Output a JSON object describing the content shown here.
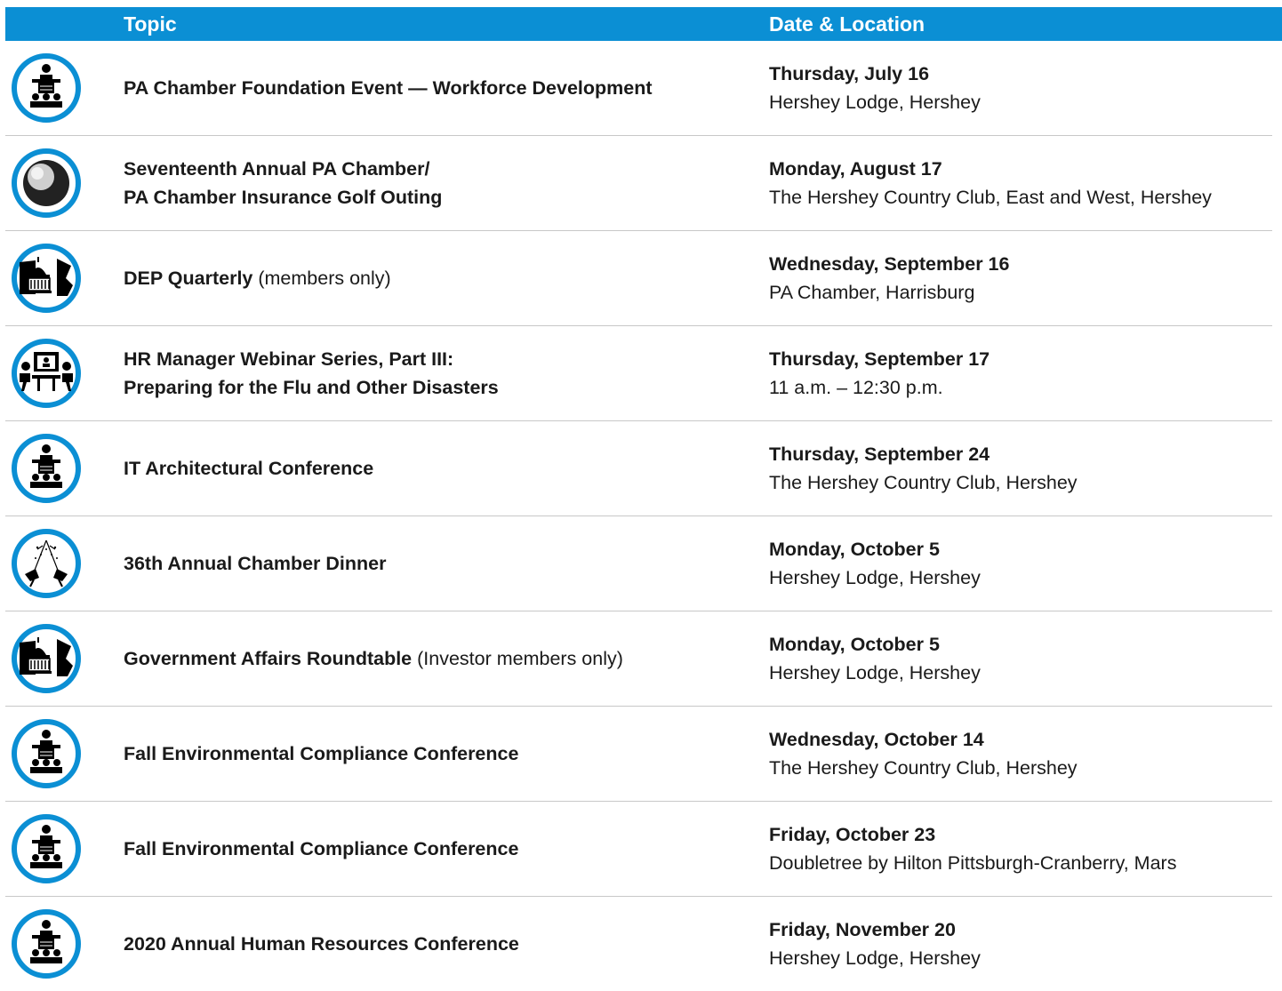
{
  "header": {
    "topic": "Topic",
    "date_location": "Date & Location"
  },
  "colors": {
    "accent": "#0b8fd4",
    "divider": "#c8c8c8"
  },
  "events": [
    {
      "icon": "conference-icon",
      "title_line1": "PA Chamber Foundation Event — Workforce Development",
      "title_line2": "",
      "note": "",
      "day": "Thursday, July 16",
      "location": "Hershey Lodge, Hershey"
    },
    {
      "icon": "golf-ball-icon",
      "title_line1": "Seventeenth Annual PA Chamber/",
      "title_line2": "PA Chamber Insurance Golf Outing",
      "note": "",
      "day": "Monday, August 17",
      "location": "The Hershey Country Club, East and West, Hershey"
    },
    {
      "icon": "capitol-map-icon",
      "title_line1": "DEP Quarterly",
      "title_line2": "",
      "note": " (members only)",
      "day": "Wednesday, September 16",
      "location": "PA Chamber, Harrisburg"
    },
    {
      "icon": "webinar-icon",
      "title_line1": "HR Manager Webinar Series, Part III:",
      "title_line2": "Preparing for the Flu and Other Disasters",
      "note": "",
      "day": "Thursday, September 17",
      "location": "11 a.m. – 12:30 p.m."
    },
    {
      "icon": "conference-icon",
      "title_line1": "IT Architectural Conference",
      "title_line2": "",
      "note": "",
      "day": "Thursday, September 24",
      "location": "The Hershey Country Club, Hershey"
    },
    {
      "icon": "toast-glasses-icon",
      "title_line1": "36th Annual Chamber Dinner",
      "title_line2": "",
      "note": "",
      "day": "Monday, October 5",
      "location": "Hershey Lodge, Hershey"
    },
    {
      "icon": "capitol-map-icon",
      "title_line1": "Government Affairs Roundtable",
      "title_line2": "",
      "note": " (Investor members only)",
      "day": "Monday, October 5",
      "location": "Hershey Lodge, Hershey"
    },
    {
      "icon": "conference-icon",
      "title_line1": "Fall Environmental Compliance Conference",
      "title_line2": "",
      "note": "",
      "day": "Wednesday, October 14",
      "location": "The Hershey Country Club, Hershey"
    },
    {
      "icon": "conference-icon",
      "title_line1": "Fall Environmental Compliance Conference",
      "title_line2": "",
      "note": "",
      "day": "Friday, October 23",
      "location": "Doubletree by Hilton Pittsburgh-Cranberry, Mars"
    },
    {
      "icon": "conference-icon",
      "title_line1": "2020 Annual Human Resources Conference",
      "title_line2": "",
      "note": "",
      "day": "Friday, November 20",
      "location": "Hershey Lodge, Hershey"
    }
  ]
}
